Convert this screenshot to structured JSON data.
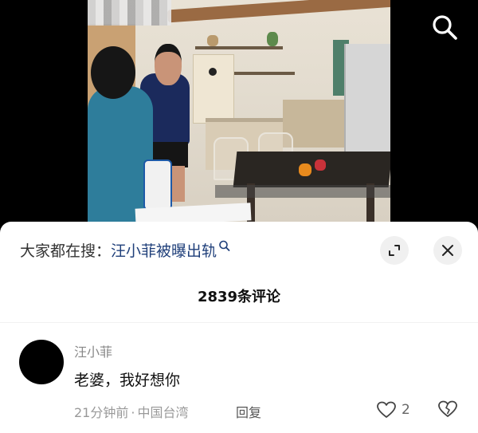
{
  "video": {
    "search_icon": "search-icon"
  },
  "comments_panel": {
    "suggestion_prefix": "大家都在搜：",
    "suggestion_query": "汪小菲被曝出轨",
    "expand_icon": "expand-icon",
    "close_icon": "close-icon",
    "comment_count": "2839条评论"
  },
  "comments": [
    {
      "author": "汪小菲",
      "text": "老婆，我好想你",
      "time": "21分钟前",
      "separator": "·",
      "location": "中国台湾",
      "reply_label": "回复",
      "likes": "2",
      "like_icon": "heart-icon",
      "dislike_icon": "broken-heart-icon"
    }
  ],
  "colors": {
    "query_link": "#1f3f7a",
    "sheet_bg": "#ffffff",
    "video_bg": "#000000"
  }
}
